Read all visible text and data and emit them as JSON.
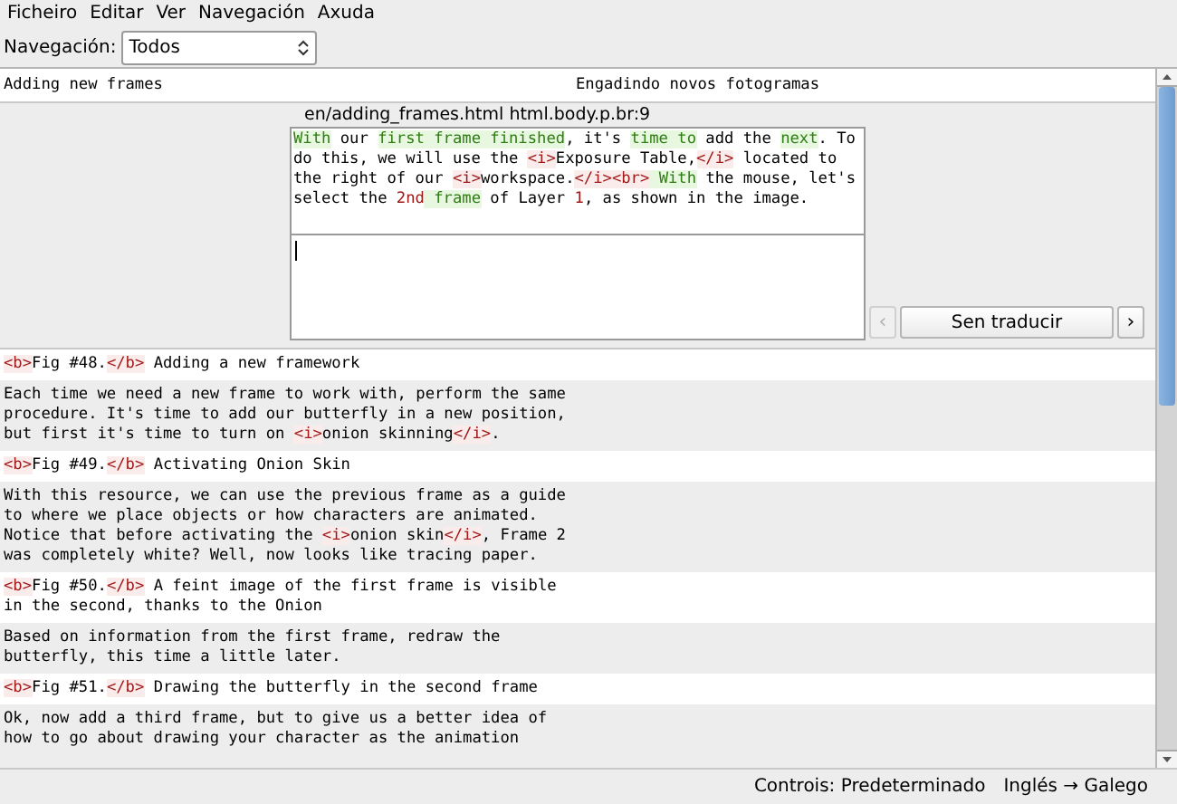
{
  "menu": [
    {
      "label": "Ficheiro"
    },
    {
      "label": "Editar"
    },
    {
      "label": "Ver"
    },
    {
      "label": "Navegación"
    },
    {
      "label": "Axuda"
    }
  ],
  "navigation": {
    "label": "Navegación:",
    "value": "Todos"
  },
  "rows_before": [
    {
      "source": "Adding new frames",
      "target": "Engadindo novos fotogramas"
    }
  ],
  "editor": {
    "location": "en/adding_frames.html html.body.p.br:9",
    "source": [
      {
        "kind": "term",
        "text": "With"
      },
      {
        "kind": "text",
        "text": " our "
      },
      {
        "kind": "term",
        "text": "first frame finished"
      },
      {
        "kind": "text",
        "text": ", it's "
      },
      {
        "kind": "term",
        "text": "time to"
      },
      {
        "kind": "text",
        "text": " add the "
      },
      {
        "kind": "term",
        "text": "next"
      },
      {
        "kind": "text",
        "text": ". To\ndo this, we will use the "
      },
      {
        "kind": "tag",
        "text": "<i>"
      },
      {
        "kind": "text",
        "text": "Exposure Table,"
      },
      {
        "kind": "tag",
        "text": "</i>"
      },
      {
        "kind": "text",
        "text": " located to\nthe right of our "
      },
      {
        "kind": "tag",
        "text": "<i>"
      },
      {
        "kind": "text",
        "text": "workspace."
      },
      {
        "kind": "tag",
        "text": "</i><br>"
      },
      {
        "kind": "term",
        "text": " With"
      },
      {
        "kind": "text",
        "text": " the mouse, let's\nselect the "
      },
      {
        "kind": "number",
        "text": "2nd"
      },
      {
        "kind": "term",
        "text": " frame"
      },
      {
        "kind": "text",
        "text": " of Layer "
      },
      {
        "kind": "number",
        "text": "1"
      },
      {
        "kind": "text",
        "text": ", as shown in the image."
      }
    ],
    "prev": {
      "label": "‹",
      "disabled": true
    },
    "status": {
      "label": "Sen traducir"
    },
    "next": {
      "label": "›",
      "disabled": false
    }
  },
  "rows_after": [
    {
      "source": [
        {
          "kind": "tag",
          "text": "<b>"
        },
        {
          "kind": "text",
          "text": "Fig #48."
        },
        {
          "kind": "tag",
          "text": "</b>"
        },
        {
          "kind": "text",
          "text": " Adding a new framework"
        }
      ]
    },
    {
      "source": [
        {
          "kind": "text",
          "text": "Each time we need a new frame to work with, perform the same\nprocedure. It's time to add our butterfly in a new position,\nbut first it's time to turn on "
        },
        {
          "kind": "tag",
          "text": "<i>"
        },
        {
          "kind": "text",
          "text": "onion skinning"
        },
        {
          "kind": "tag",
          "text": "</i>"
        },
        {
          "kind": "text",
          "text": "."
        }
      ]
    },
    {
      "source": [
        {
          "kind": "tag",
          "text": "<b>"
        },
        {
          "kind": "text",
          "text": "Fig #49."
        },
        {
          "kind": "tag",
          "text": "</b>"
        },
        {
          "kind": "text",
          "text": " Activating Onion Skin"
        }
      ]
    },
    {
      "source": [
        {
          "kind": "text",
          "text": "With this resource, we can use the previous frame as a guide\nto where we place objects or how characters are animated.\nNotice that before activating the "
        },
        {
          "kind": "tag",
          "text": "<i>"
        },
        {
          "kind": "text",
          "text": "onion skin"
        },
        {
          "kind": "tag",
          "text": "</i>"
        },
        {
          "kind": "text",
          "text": ", Frame 2\nwas completely white? Well, now looks like tracing paper."
        }
      ]
    },
    {
      "source": [
        {
          "kind": "tag",
          "text": "<b>"
        },
        {
          "kind": "text",
          "text": "Fig #50."
        },
        {
          "kind": "tag",
          "text": "</b>"
        },
        {
          "kind": "text",
          "text": " A feint image of the first frame is visible\nin the second, thanks to the Onion"
        }
      ]
    },
    {
      "source": [
        {
          "kind": "text",
          "text": "Based on information from the first frame, redraw the\nbutterfly, this time a little later."
        }
      ]
    },
    {
      "source": [
        {
          "kind": "tag",
          "text": "<b>"
        },
        {
          "kind": "text",
          "text": "Fig #51."
        },
        {
          "kind": "tag",
          "text": "</b>"
        },
        {
          "kind": "text",
          "text": " Drawing the butterfly in the second frame"
        }
      ]
    },
    {
      "source": [
        {
          "kind": "text",
          "text": "Ok, now add a third frame, but to give us a better idea of\nhow to go about drawing your character as the animation"
        }
      ]
    }
  ],
  "status_bar": {
    "controls": "Controis: Predeterminado",
    "languages": "Inglés → Galego"
  }
}
